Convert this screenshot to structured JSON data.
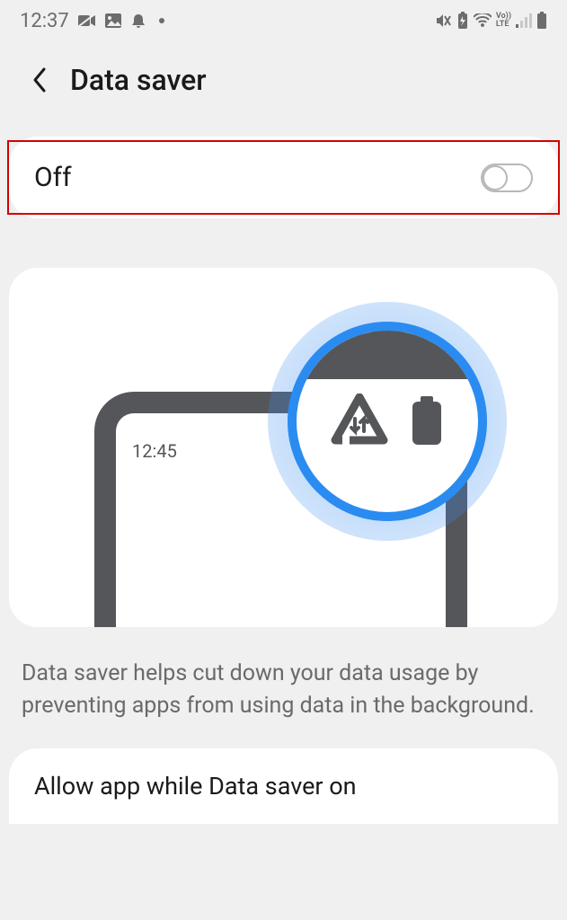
{
  "status_bar": {
    "time": "12:37",
    "icons_left": [
      "video-off-icon",
      "image-icon",
      "bell-icon",
      "dot-icon"
    ],
    "icons_right": [
      "vibrate-mute-icon",
      "battery-saver-icon",
      "wifi-icon",
      "volte-icon",
      "signal-icon",
      "battery-icon"
    ]
  },
  "header": {
    "title": "Data saver"
  },
  "toggle": {
    "label": "Off",
    "state": "off"
  },
  "illustration": {
    "phone_time": "12:45"
  },
  "description": "Data saver helps cut down your data usage by preventing apps from using data in the background.",
  "option": {
    "label": "Allow app while Data saver on"
  },
  "annotations": {
    "red_box": true,
    "red_arrow": true
  }
}
